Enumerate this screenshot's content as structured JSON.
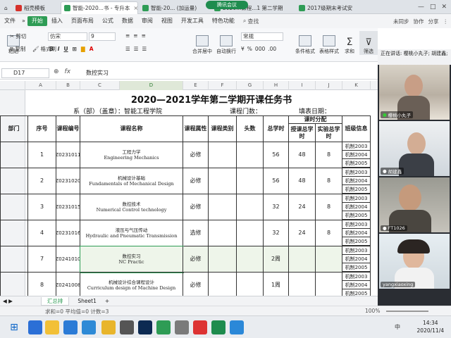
{
  "tabs": [
    {
      "label": "稻壳模板",
      "color": "#d6312b"
    },
    {
      "label": "智能-2020...书 - 专升本",
      "color": "#2e9c55"
    },
    {
      "label": "智能-20... (加运量)",
      "color": "#2e9c55"
    },
    {
      "label": "2020...课程...1 第二学期",
      "color": "#2e9c55"
    },
    {
      "label": "2017级期末考试安排",
      "color": "#2e9c55"
    }
  ],
  "meeting_pill": "腾讯会议",
  "menus": [
    "文件",
    "开始",
    "插入",
    "页面布局",
    "公式",
    "数据",
    "审阅",
    "视图",
    "开发工具",
    "特色功能"
  ],
  "menu_right": [
    "未同步",
    "协作",
    "分享"
  ],
  "search_label": "查找",
  "ribbon": {
    "cut": "剪切",
    "copy": "复制",
    "painter": "格式刷",
    "paste": "粘贴",
    "font": "仿宋",
    "size": "9",
    "numfmt": "常规",
    "merge": "合并居中",
    "wrap": "自动换行",
    "cond": "条件格式",
    "tablestyle": "表格样式",
    "sum": "求和",
    "filter": "筛选"
  },
  "namebox": "D17",
  "formula": "数控实习",
  "columns": [
    "A",
    "B",
    "C",
    "D",
    "E",
    "F",
    "G",
    "H",
    "I",
    "J",
    "K"
  ],
  "sheet": {
    "title": "2020—2021学年第二学期开课任务书",
    "dept": "系（部）（盖章）：智能工程学院",
    "count": "课程门数：",
    "date": "填表日期：",
    "headers": {
      "dept": "部门",
      "seq": "序号",
      "code": "课程编号",
      "name": "课程名称",
      "attr": "课程属性",
      "type": "课程类别",
      "num": "头数",
      "total": "总学时",
      "dist": "课时分配",
      "lecture": "授课总学时",
      "lab": "实验总学时",
      "cls": "班级信息"
    },
    "rows": [
      {
        "seq": "1",
        "code": "Z0231011",
        "cn": "工程力学",
        "en": "Engineering Mechanics",
        "attr": "必修",
        "total": "56",
        "lec": "48",
        "lab": "8",
        "classes": [
          "机制2003",
          "机制2004",
          "机制2005"
        ]
      },
      {
        "seq": "2",
        "code": "Z0231020",
        "cn": "机械设计基础",
        "en": "Fundamentals of Mechanical Design",
        "attr": "必修",
        "total": "56",
        "lec": "48",
        "lab": "8",
        "classes": [
          "机制2003",
          "机制2004",
          "机制2005"
        ]
      },
      {
        "seq": "3",
        "code": "Z0231015",
        "cn": "数控技术",
        "en": "Numerical Control technology",
        "attr": "必修",
        "total": "32",
        "lec": "24",
        "lab": "8",
        "classes": [
          "机制2003",
          "机制2004",
          "机制2005"
        ]
      },
      {
        "seq": "4",
        "code": "Z0231016",
        "cn": "液压与气压传动",
        "en": "Hydraulic and Pneumatic Transmission",
        "attr": "选修",
        "total": "32",
        "lec": "24",
        "lab": "8",
        "classes": [
          "机制2003",
          "机制2004",
          "机制2005"
        ]
      },
      {
        "seq": "7",
        "code": "Z0241010",
        "cn": "数控实习",
        "en": "NC Practic",
        "attr": "必修",
        "total": "2周",
        "lec": "",
        "lab": "",
        "classes": [
          "机制2003",
          "机制2004",
          "机制2005"
        ]
      },
      {
        "seq": "8",
        "code": "Z0241008",
        "cn": "机械设计综合课程设计",
        "en": "Curriculum design of Machine Design",
        "attr": "必修",
        "total": "1周",
        "lec": "",
        "lab": "",
        "classes": [
          "机制2003",
          "机制2004",
          "机制2005"
        ]
      }
    ]
  },
  "sheet_tabs": [
    "汇总排",
    "Sheet1",
    "+"
  ],
  "status": {
    "left": "求和=0  平均值=0  计数=3",
    "zoom": "100%"
  },
  "speaking": "正在讲话: 樱桃小丸子; 胡建鑫;",
  "participants": [
    "樱桃小丸子",
    "胡建鑫",
    "FT1026",
    "yangxiaoxing"
  ],
  "clock": {
    "time": "14:34",
    "date": "2020/11/4"
  },
  "lang": "中"
}
